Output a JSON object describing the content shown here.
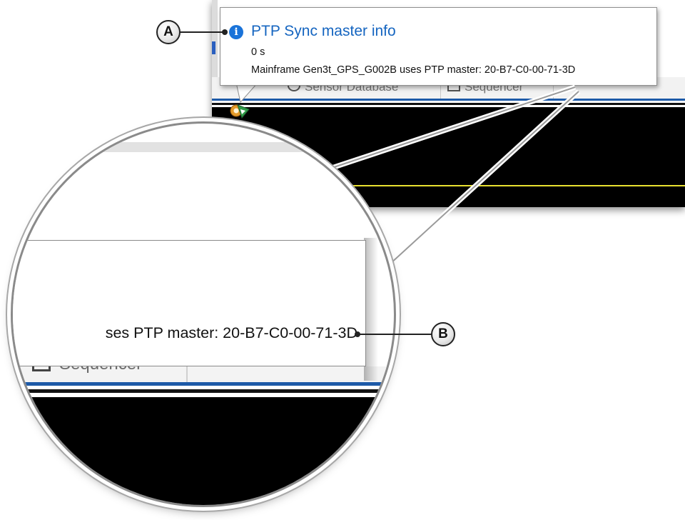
{
  "notification": {
    "title": "PTP Sync master info",
    "time": "0 s",
    "message": "Mainframe Gen3t_GPS_G002B uses PTP master: 20-B7-C0-00-71-3D",
    "icon": "info-icon",
    "title_color": "#1565c0",
    "icon_color": "#1a73d9"
  },
  "background_app": {
    "tabs": [
      {
        "label": "Sensor Database",
        "icon": "database-icon"
      },
      {
        "label": "Sequencer",
        "icon": "sequencer-icon"
      }
    ],
    "tray_icon": "ptp-sync-tray-icon",
    "trace_color": "#e8e030",
    "tab_underline_color": "#1d5aa8"
  },
  "magnifier": {
    "message_fragment": "ses PTP master: 20-B7-C0-00-71-3D",
    "tab_label": "Sequencer"
  },
  "callouts": {
    "a": "A",
    "b": "B"
  }
}
